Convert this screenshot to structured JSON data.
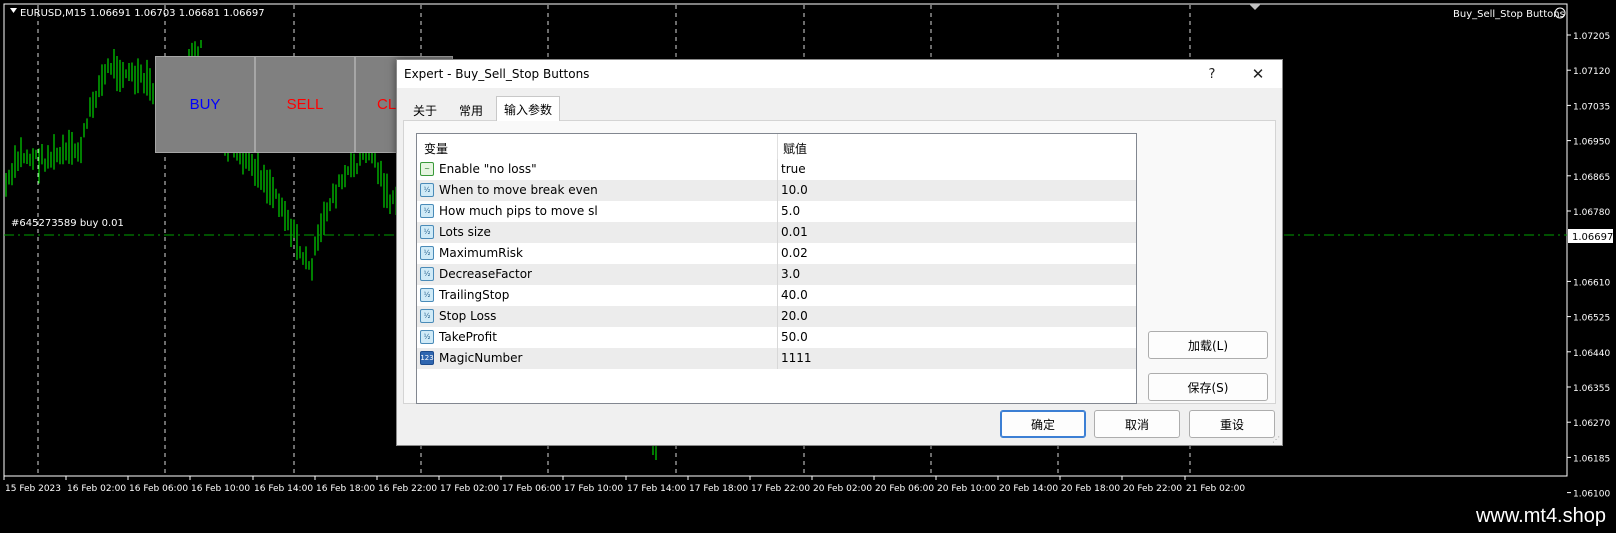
{
  "chart": {
    "symbol_line": "EURUSD,M15  1.06691 1.06703 1.06681 1.06697",
    "indicator_label": "Buy_Sell_Stop Buttons",
    "order_label": "#645273589 buy 0.01",
    "current_price": "1.06697",
    "price_ticks": [
      "1.07205",
      "1.07120",
      "1.07035",
      "1.06950",
      "1.06865",
      "1.06780",
      "1.06697",
      "1.06610",
      "1.06525",
      "1.06440",
      "1.06355",
      "1.06270",
      "1.06185",
      "1.06100"
    ],
    "time_ticks": [
      "15 Feb 2023",
      "16 Feb 02:00",
      "16 Feb 06:00",
      "16 Feb 10:00",
      "16 Feb 14:00",
      "16 Feb 18:00",
      "16 Feb 22:00",
      "17 Feb 02:00",
      "17 Feb 06:00",
      "17 Feb 10:00",
      "17 Feb 14:00",
      "17 Feb 18:00",
      "17 Feb 22:00",
      "20 Feb 02:00",
      "20 Feb 06:00",
      "20 Feb 10:00",
      "20 Feb 14:00",
      "20 Feb 18:00",
      "20 Feb 22:00",
      "21 Feb 02:00"
    ],
    "colors": {
      "background": "#000000",
      "candles": "#00ff00",
      "grid": "#ffffff",
      "order_line": "#00a000",
      "price_box": "#ffffff"
    }
  },
  "ea_buttons": {
    "buy": {
      "label": "BUY",
      "color": "#0000ff"
    },
    "sell": {
      "label": "SELL",
      "color": "#ff0000"
    },
    "close": {
      "label": "CL",
      "color": "#ff0000"
    }
  },
  "dialog": {
    "title": "Expert - Buy_Sell_Stop Buttons",
    "help_label": "?",
    "close_label": "✕",
    "tabs": [
      {
        "label": "关于",
        "active": false
      },
      {
        "label": "常用",
        "active": false
      },
      {
        "label": "输入参数",
        "active": true
      }
    ],
    "grid": {
      "col_variable": "变量",
      "col_value": "赋值",
      "rows": [
        {
          "name": "Enable \"no loss\"",
          "value": "true",
          "icon": "bool-icon",
          "icon_text": "~"
        },
        {
          "name": "When to move break even",
          "value": "10.0",
          "icon": "double-icon",
          "icon_text": "½"
        },
        {
          "name": "How much pips to move sl",
          "value": "5.0",
          "icon": "double-icon",
          "icon_text": "½"
        },
        {
          "name": "Lots size",
          "value": "0.01",
          "icon": "double-icon",
          "icon_text": "½"
        },
        {
          "name": "MaximumRisk",
          "value": "0.02",
          "icon": "double-icon",
          "icon_text": "½"
        },
        {
          "name": "DecreaseFactor",
          "value": "3.0",
          "icon": "double-icon",
          "icon_text": "½"
        },
        {
          "name": "TrailingStop",
          "value": "40.0",
          "icon": "double-icon",
          "icon_text": "½"
        },
        {
          "name": "Stop Loss",
          "value": "20.0",
          "icon": "double-icon",
          "icon_text": "½"
        },
        {
          "name": "TakeProfit",
          "value": "50.0",
          "icon": "double-icon",
          "icon_text": "½"
        },
        {
          "name": "MagicNumber",
          "value": "1111",
          "icon": "int-icon",
          "icon_text": "123"
        }
      ]
    },
    "load_label": "加载(L)",
    "save_label": "保存(S)",
    "ok_label": "确定",
    "cancel_label": "取消",
    "reset_label": "重设"
  },
  "footer": {
    "watermark": "www.mt4.shop"
  }
}
